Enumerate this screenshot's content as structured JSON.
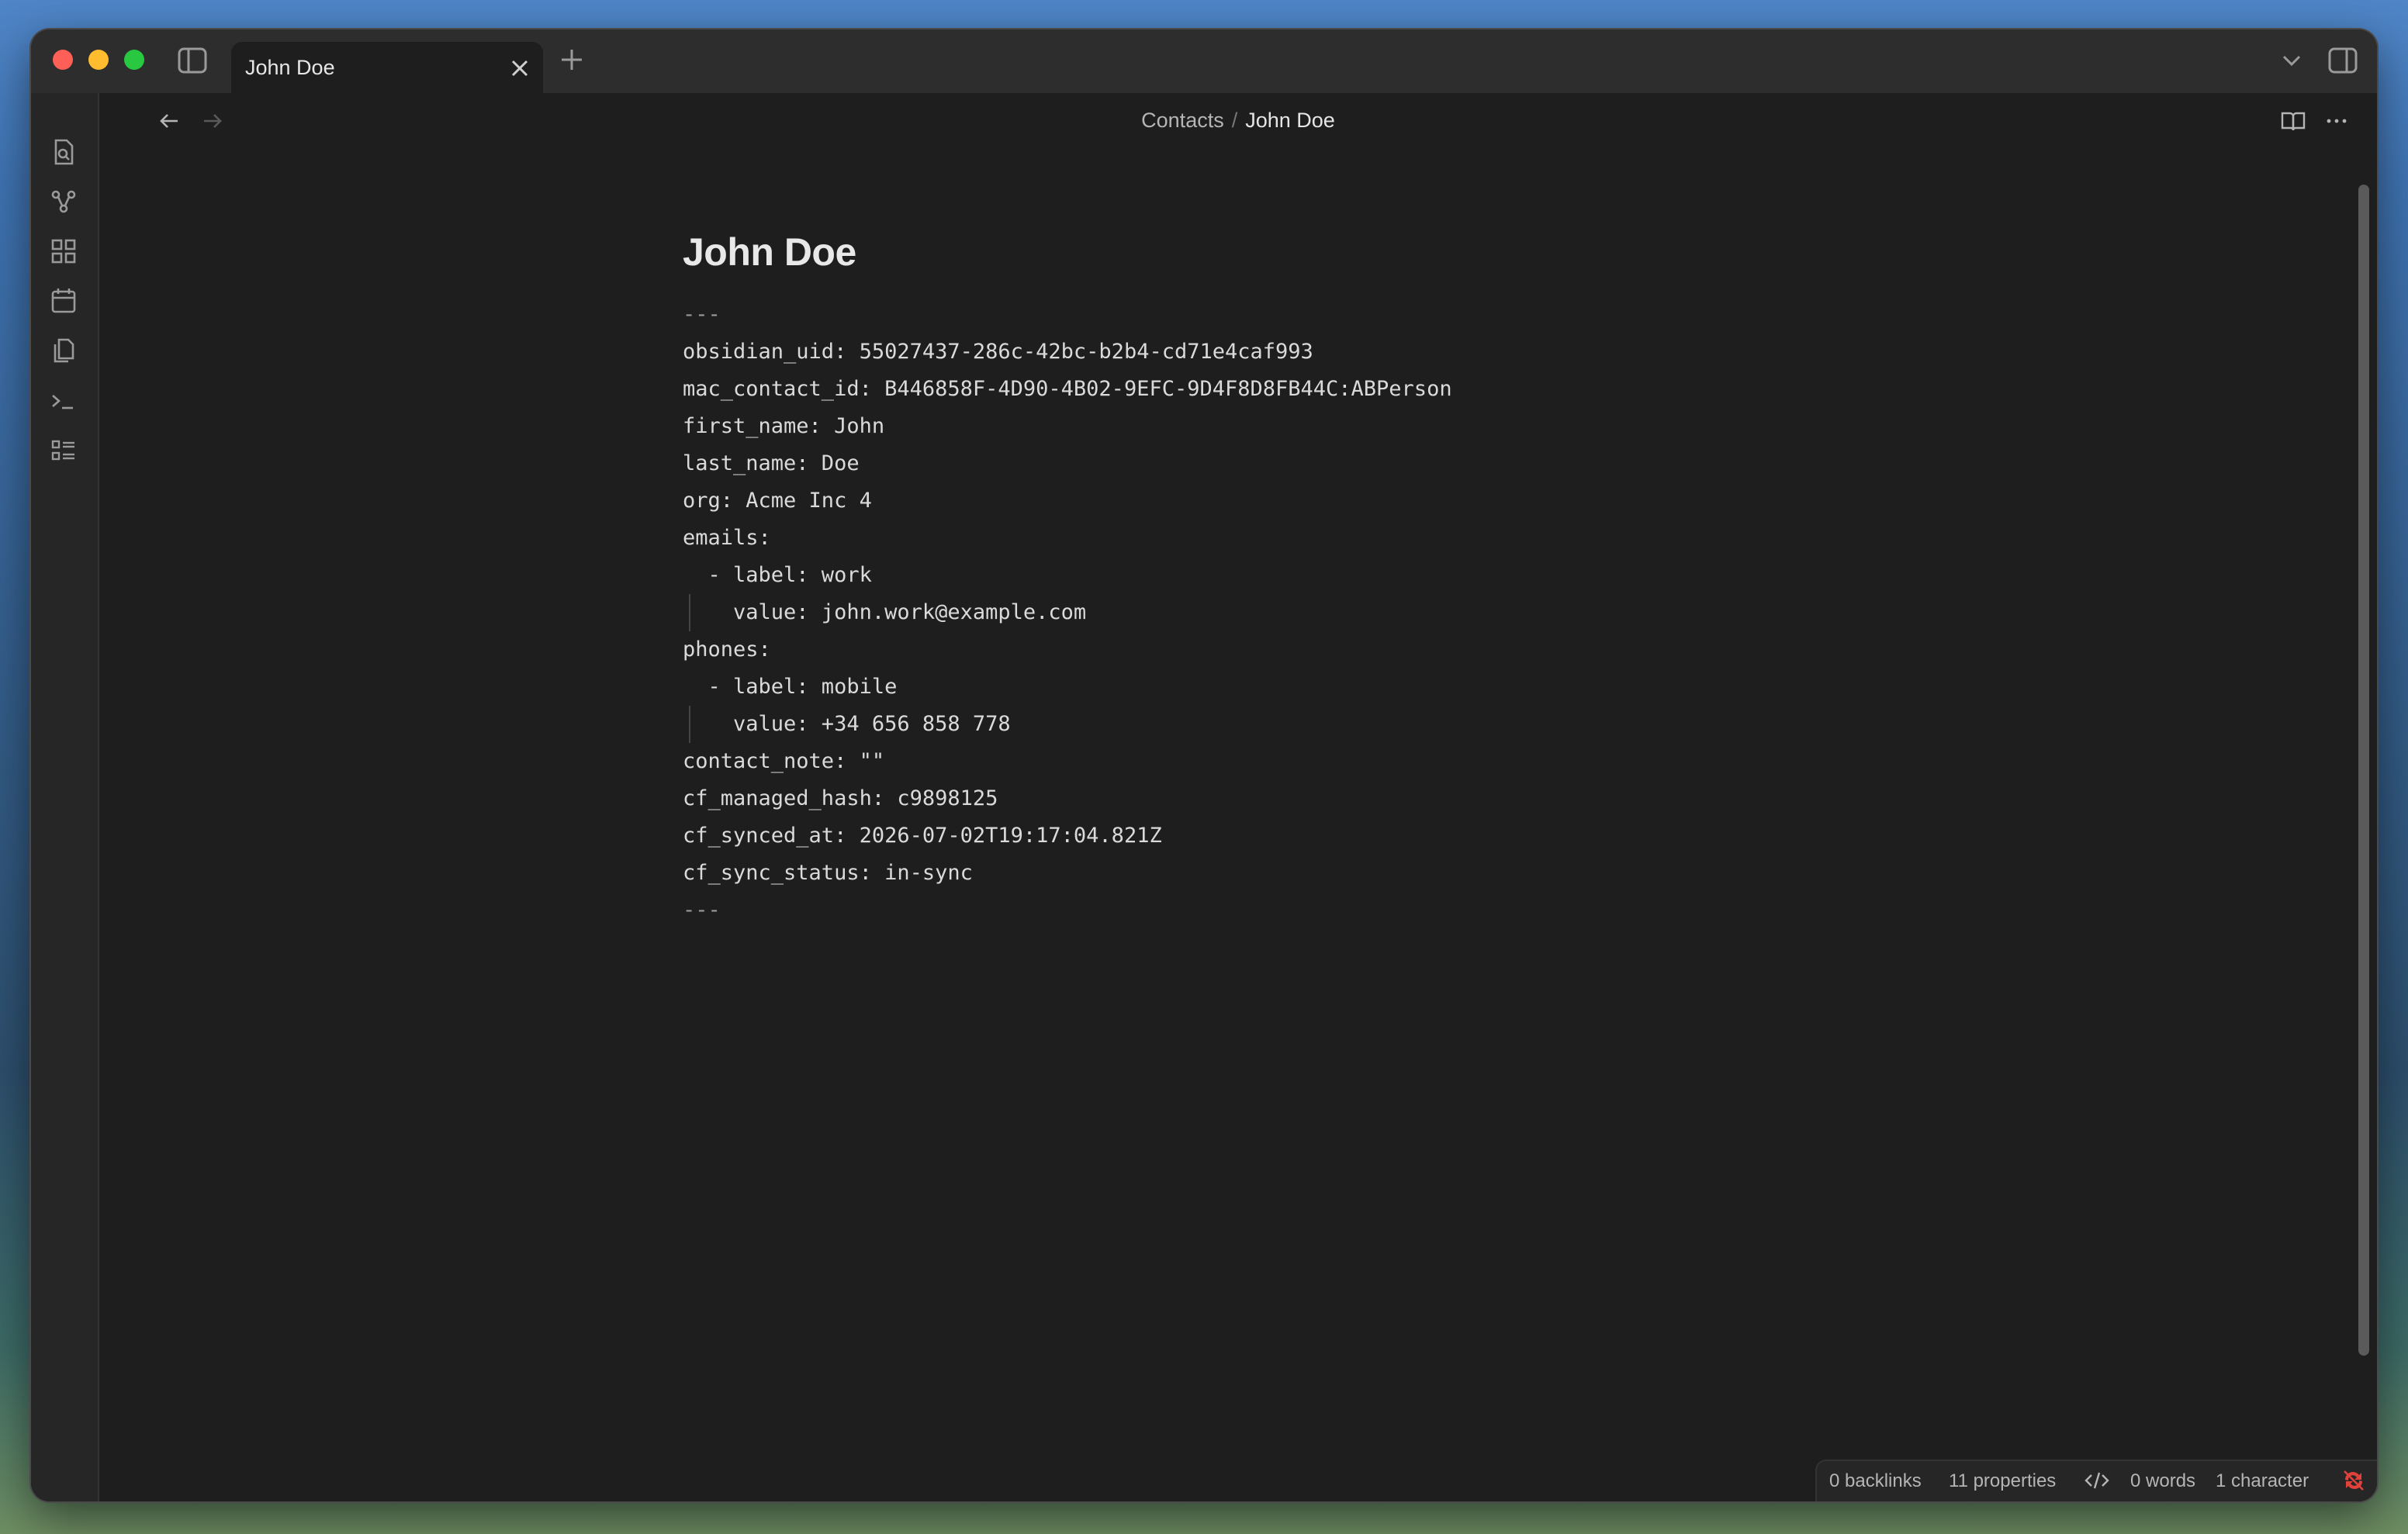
{
  "tab": {
    "title": "John Doe"
  },
  "breadcrumb": {
    "parent": "Contacts",
    "separator": "/",
    "current": "John Doe"
  },
  "note": {
    "title": "John Doe",
    "lines": [
      "---",
      "obsidian_uid: 55027437-286c-42bc-b2b4-cd71e4caf993",
      "mac_contact_id: B446858F-4D90-4B02-9EFC-9D4F8D8FB44C:ABPerson",
      "first_name: John",
      "last_name: Doe",
      "org: Acme Inc 4",
      "emails:",
      "  - label: work",
      "    value: john.work@example.com",
      "phones:",
      "  - label: mobile",
      "    value: +34 656 858 778",
      "contact_note: \"\"",
      "cf_managed_hash: c9898125",
      "cf_synced_at: 2026-07-02T19:17:04.821Z",
      "cf_sync_status: in-sync",
      "---"
    ]
  },
  "ribbon_icons": [
    "search-icon",
    "graph-icon",
    "blocks-icon",
    "calendar-icon",
    "copy-icon",
    "terminal-icon",
    "list-icon"
  ],
  "status": {
    "backlinks": "0 backlinks",
    "properties": "11 properties",
    "words": "0 words",
    "characters": "1 character"
  },
  "colors": {
    "background": "#1e1e1e",
    "titlebar": "#2d2d2d",
    "text": "#dadada",
    "sync_error": "#e0413b"
  }
}
